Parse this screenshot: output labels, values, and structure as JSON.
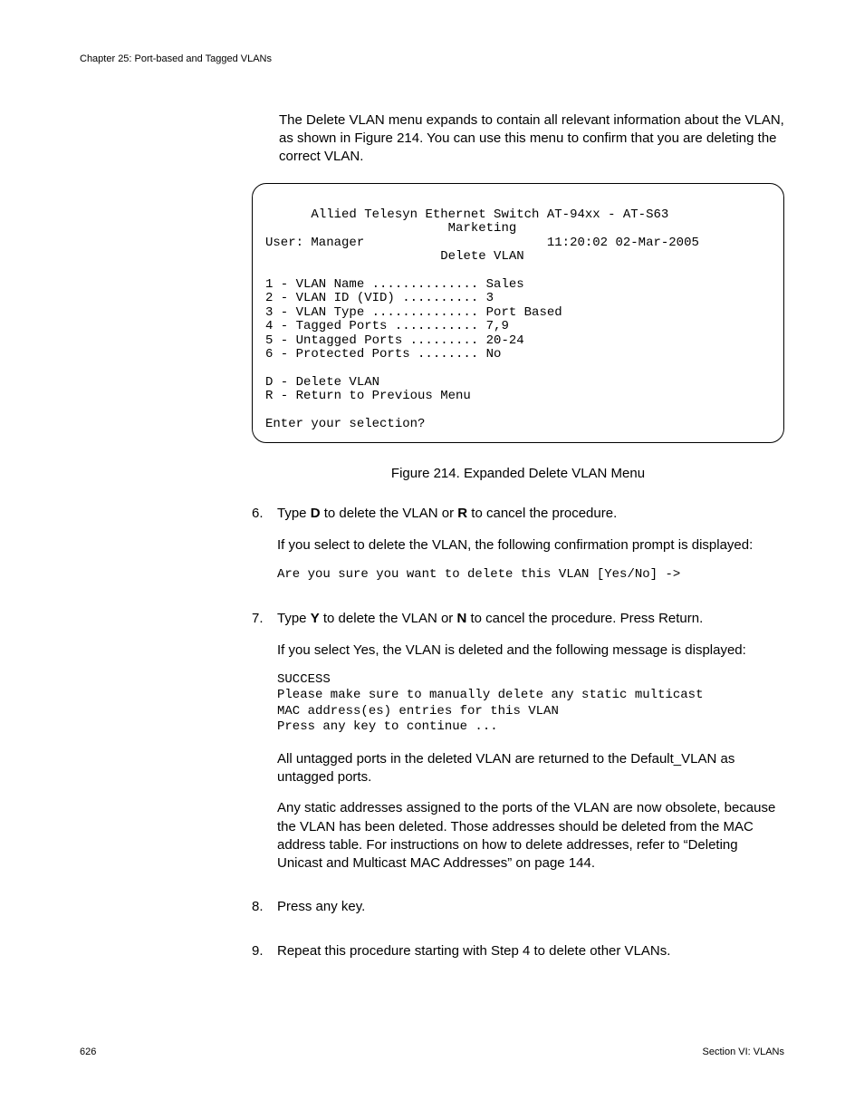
{
  "chapter": "Chapter 25: Port-based and Tagged VLANs",
  "intro": "The Delete VLAN menu expands to contain all relevant information about the VLAN, as shown in Figure 214. You can use this menu to confirm that you are deleting the correct VLAN.",
  "terminal": {
    "title": "Allied Telesyn Ethernet Switch AT-94xx - AT-S63",
    "subtitle": "Marketing",
    "user_label": "User: Manager",
    "datetime": "11:20:02 02-Mar-2005",
    "menu_title": "Delete VLAN",
    "lines": [
      "1 - VLAN Name .............. Sales",
      "2 - VLAN ID (VID) .......... 3",
      "3 - VLAN Type .............. Port Based",
      "4 - Tagged Ports ........... 7,9",
      "5 - Untagged Ports ......... 20-24",
      "6 - Protected Ports ........ No"
    ],
    "cmd_d": "D - Delete VLAN",
    "cmd_r": "R - Return to Previous Menu",
    "prompt": "Enter your selection?"
  },
  "caption": "Figure 214. Expanded Delete VLAN Menu",
  "steps": {
    "s6": {
      "num": "6.",
      "t1a": "Type ",
      "t1b": "D",
      "t1c": " to delete the VLAN or ",
      "t1d": "R",
      "t1e": " to cancel the procedure.",
      "t2": "If you select to delete the VLAN, the following confirmation prompt is displayed:",
      "code": "Are you sure you want to delete this VLAN [Yes/No] ->"
    },
    "s7": {
      "num": "7.",
      "t1a": "Type ",
      "t1b": "Y",
      "t1c": " to delete the VLAN or ",
      "t1d": "N",
      "t1e": " to cancel the procedure. Press Return.",
      "t2": "If you select Yes, the VLAN is deleted and the following message is displayed:",
      "code": "SUCCESS\nPlease make sure to manually delete any static multicast\nMAC address(es) entries for this VLAN\nPress any key to continue ...",
      "t3": "All untagged ports in the deleted VLAN are returned to the Default_VLAN as untagged ports.",
      "t4": "Any static addresses assigned to the ports of the VLAN are now obsolete, because the VLAN has been deleted. Those addresses should be deleted from the MAC address table. For instructions on how to delete addresses, refer to “Deleting Unicast and Multicast MAC Addresses” on page 144."
    },
    "s8": {
      "num": "8.",
      "t1": "Press any key."
    },
    "s9": {
      "num": "9.",
      "t1": "Repeat this procedure starting with Step 4 to delete other VLANs."
    }
  },
  "footer": {
    "page": "626",
    "section": "Section VI: VLANs"
  }
}
